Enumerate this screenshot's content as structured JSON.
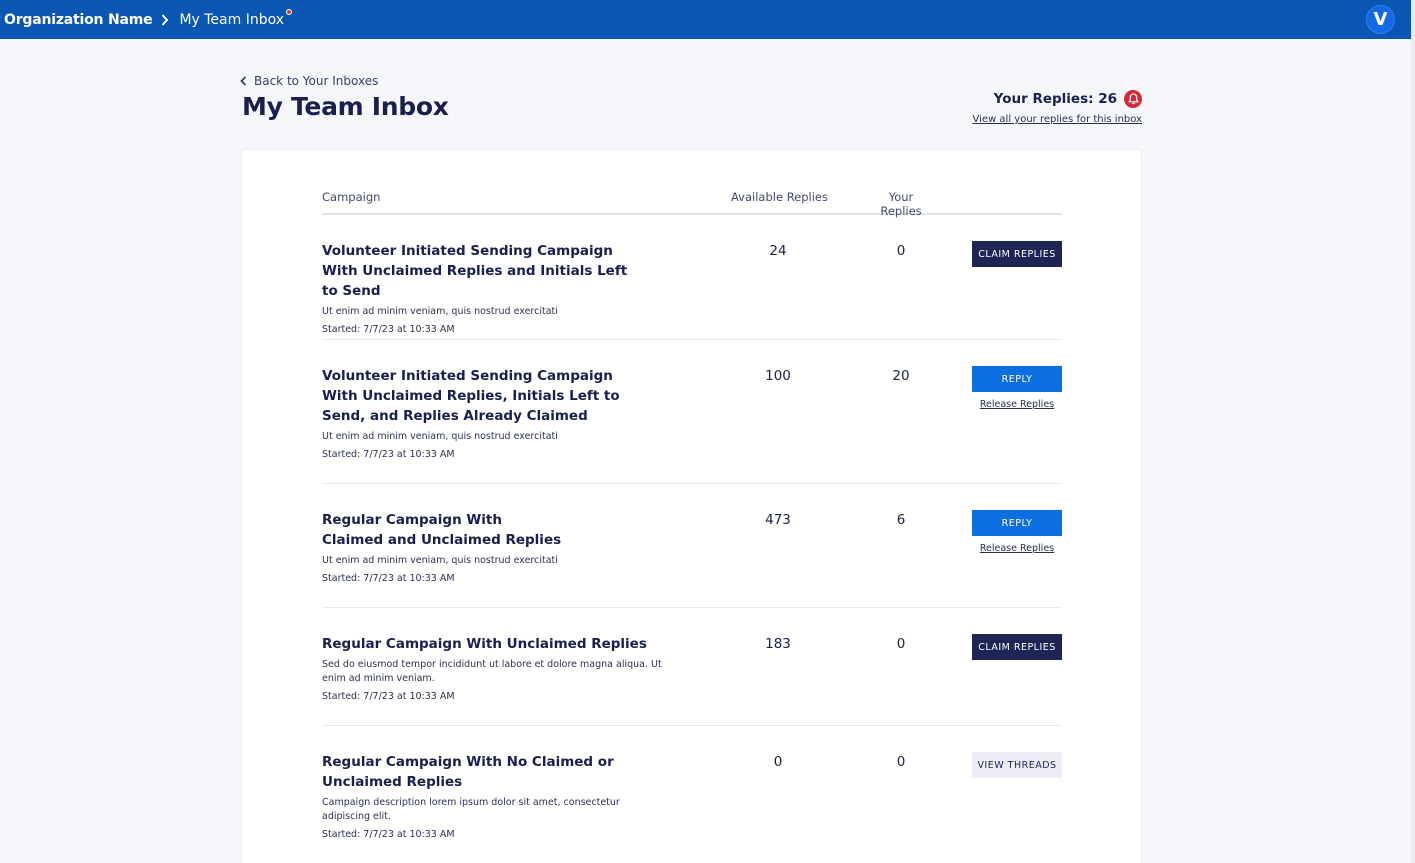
{
  "topbar": {
    "org_name": "Organization Name",
    "current_page": "My Team Inbox",
    "avatar_letter": "V"
  },
  "header": {
    "back_label": "Back to Your Inboxes",
    "title": "My Team Inbox",
    "your_replies_label": "Your Replies: 26",
    "view_all_label": "View all your replies for this inbox"
  },
  "table": {
    "columns": [
      "Campaign",
      "Available Replies",
      "Your Replies"
    ],
    "rows": [
      {
        "title": "Volunteer Initiated Sending Campaign With Unclaimed Replies and Initials Left to Send",
        "description": "Ut enim ad minim veniam, quis nostrud exercitati",
        "started": "Started: 7/7/23 at 10:33 AM",
        "available": "24",
        "yours": "0",
        "action": "CLAIM REPLIES"
      },
      {
        "title": "Volunteer Initiated Sending Campaign With Unclaimed Replies, Initials Left to Send, and Replies Already Claimed",
        "description": "Ut enim ad minim veniam, quis nostrud exercitati",
        "started": "Started: 7/7/23 at 10:33 AM",
        "available": "100",
        "yours": "20",
        "action": "REPLY",
        "secondary": "Release Replies"
      },
      {
        "title": "Regular Campaign With Claimed and Unclaimed Replies",
        "description": "Ut enim ad minim veniam, quis nostrud exercitati",
        "started": "Started: 7/7/23 at 10:33 AM",
        "available": "473",
        "yours": "6",
        "action": "REPLY",
        "secondary": "Release Replies"
      },
      {
        "title": "Regular Campaign With Unclaimed Replies",
        "description": "Sed do eiusmod tempor incididunt ut labore et dolore magna aliqua. Ut enim ad minim veniam.",
        "started": "Started: 7/7/23 at 10:33 AM",
        "available": "183",
        "yours": "0",
        "action": "CLAIM REPLIES"
      },
      {
        "title": "Regular Campaign With No Claimed or Unclaimed Replies",
        "description": "Campaign description lorem ipsum dolor sit amet, consectetur adipiscing elit.",
        "started": "Started: 7/7/23 at 10:33 AM",
        "available": "0",
        "yours": "0",
        "action": "VIEW THREADS"
      }
    ]
  },
  "colors": {
    "topbar": "#0b56b3",
    "navy": "#1e2555",
    "reply_blue": "#0b6fe0",
    "alert_red": "#d62839"
  }
}
